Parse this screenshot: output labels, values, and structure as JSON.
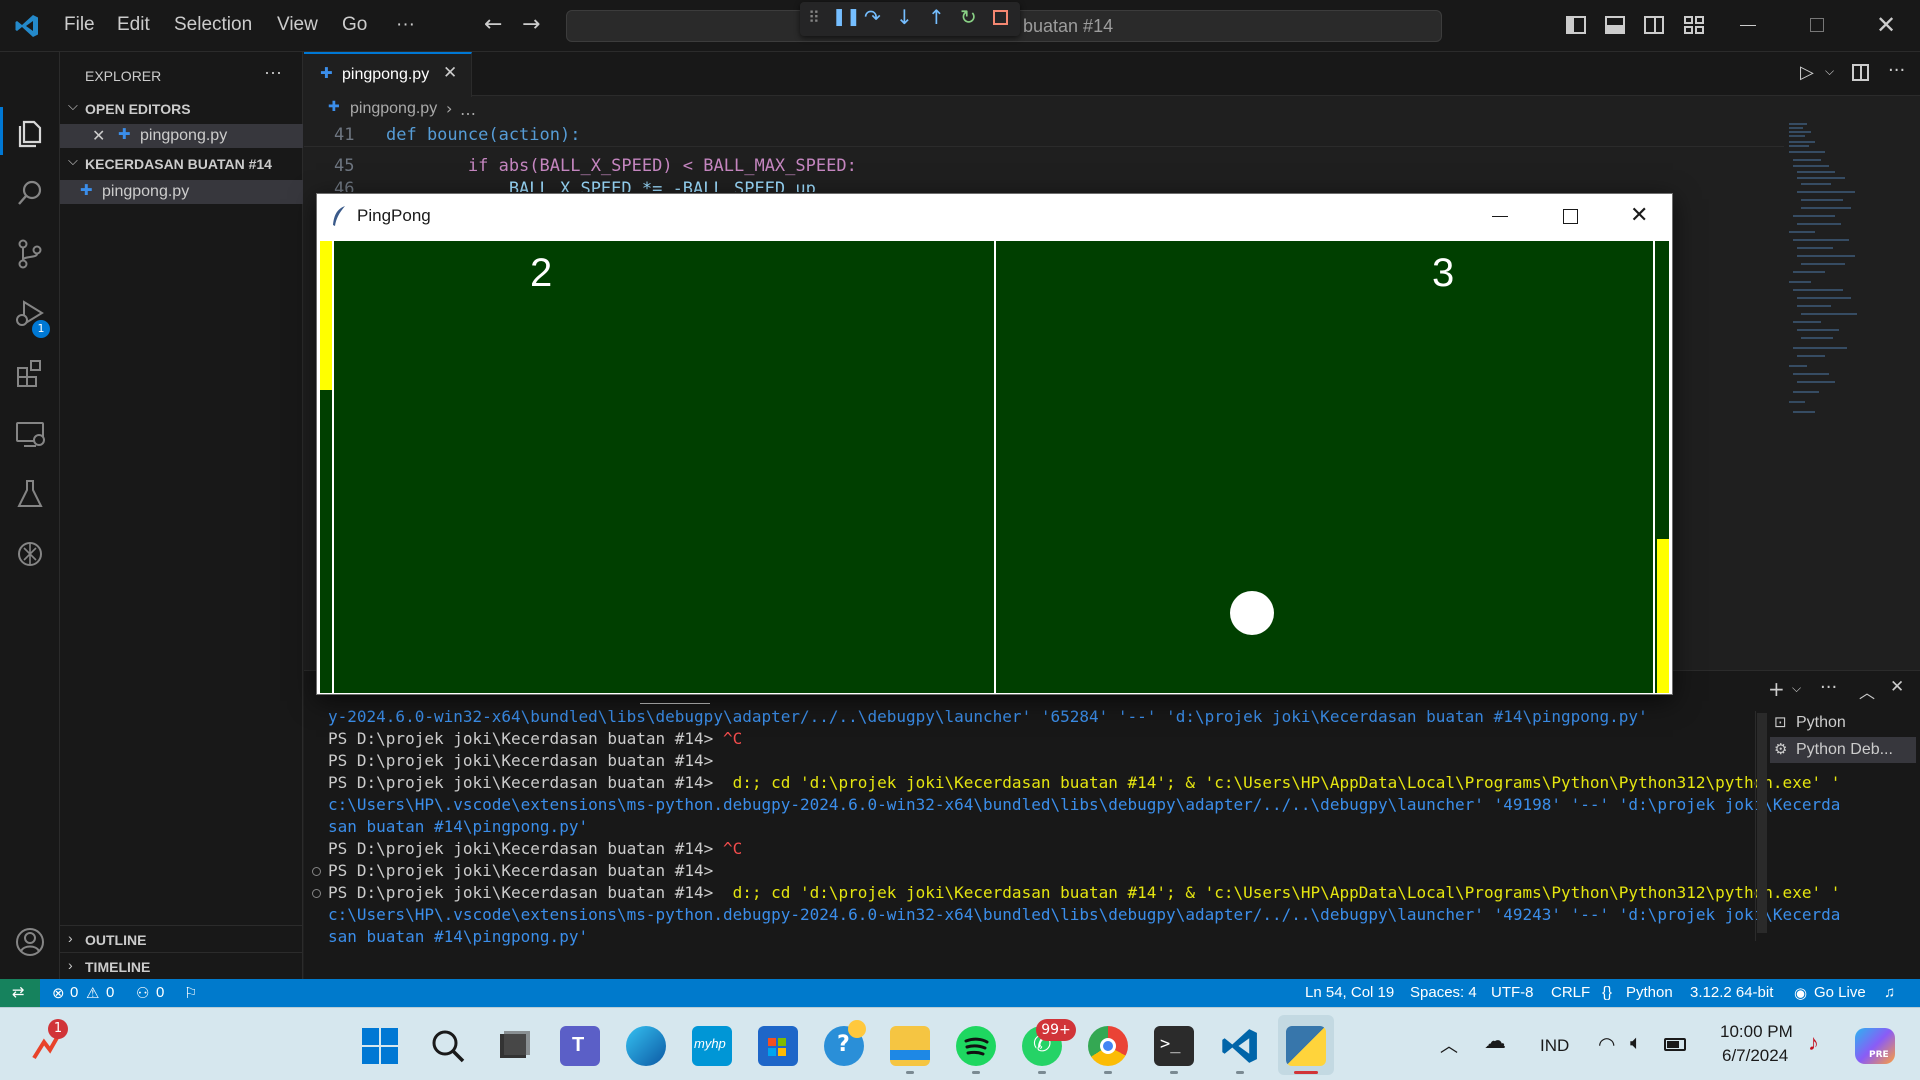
{
  "titlebar": {
    "menus": [
      "File",
      "Edit",
      "Selection",
      "View",
      "Go",
      "···"
    ],
    "search_text": "buatan #14"
  },
  "activity": {
    "debug_badge": "1"
  },
  "sidebar": {
    "header": "EXPLORER",
    "more": "···",
    "open_editors_label": "OPEN EDITORS",
    "open_editor_file": "pingpong.py",
    "folder_label": "KECERDASAN BUATAN #14",
    "folder_file": "pingpong.py",
    "outline_label": "OUTLINE",
    "timeline_label": "TIMELINE"
  },
  "editor": {
    "tab_label": "pingpong.py",
    "breadcrumb_file": "pingpong.py",
    "breadcrumb_rest": "…",
    "lines": [
      {
        "num": "41",
        "text": "def bounce(action):"
      },
      {
        "num": "45",
        "text": "        if abs(BALL_X_SPEED) < BALL_MAX_SPEED:"
      },
      {
        "num": "46",
        "text": "            BALL_X_SPEED *= -BALL_SPEED_up"
      }
    ]
  },
  "pingpong": {
    "title": "PingPong",
    "score_left": "2",
    "score_right": "3",
    "left_paddle_fill": 0.33,
    "right_paddle_fill": 0.34
  },
  "terminal": {
    "lines": [
      {
        "prompt": "",
        "text": "y-2024.6.0-win32-x64\\bundled\\libs\\debugpy\\adapter/../..\\debugpy\\launcher' '65284' '--' 'd:\\projek joki\\Kecerdasan buatan #14\\pingpong.py'",
        "style": "blue"
      },
      {
        "prompt": "PS D:\\projek joki\\Kecerdasan buatan #14> ",
        "text": "^C",
        "style": "red"
      },
      {
        "prompt": "PS D:\\projek joki\\Kecerdasan buatan #14>",
        "text": "",
        "style": ""
      },
      {
        "prompt": "PS D:\\projek joki\\Kecerdasan buatan #14>  ",
        "text": "d:; cd 'd:\\projek joki\\Kecerdasan buatan #14'; & 'c:\\Users\\HP\\AppData\\Local\\Programs\\Python\\Python312\\python.exe' '",
        "style": "mixed"
      },
      {
        "prompt": "",
        "text": "c:\\Users\\HP\\.vscode\\extensions\\ms-python.debugpy-2024.6.0-win32-x64\\bundled\\libs\\debugpy\\adapter/../..\\debugpy\\launcher' '49198' '--' 'd:\\projek joki\\Kecerda",
        "style": "blue"
      },
      {
        "prompt": "",
        "text": "san buatan #14\\pingpong.py'",
        "style": "blue"
      },
      {
        "prompt": "PS D:\\projek joki\\Kecerdasan buatan #14> ",
        "text": "^C",
        "style": "red"
      },
      {
        "prompt": "PS D:\\projek joki\\Kecerdasan buatan #14>",
        "text": "",
        "style": ""
      },
      {
        "prompt": "PS D:\\projek joki\\Kecerdasan buatan #14>  ",
        "text": "d:; cd 'd:\\projek joki\\Kecerdasan buatan #14'; & 'c:\\Users\\HP\\AppData\\Local\\Programs\\Python\\Python312\\python.exe' '",
        "style": "mixed"
      },
      {
        "prompt": "",
        "text": "c:\\Users\\HP\\.vscode\\extensions\\ms-python.debugpy-2024.6.0-win32-x64\\bundled\\libs\\debugpy\\adapter/../..\\debugpy\\launcher' '49243' '--' 'd:\\projek joki\\Kecerda",
        "style": "blue"
      },
      {
        "prompt": "",
        "text": "san buatan #14\\pingpong.py'",
        "style": "blue"
      }
    ],
    "sessions": [
      "Python",
      "Python Deb..."
    ]
  },
  "statusbar": {
    "errors": "0",
    "warnings": "0",
    "ports": "0",
    "position": "Ln 54, Col 19",
    "spaces": "Spaces: 4",
    "encoding": "UTF-8",
    "eol": "CRLF",
    "language": "Python",
    "interpreter": "3.12.2 64-bit",
    "golive": "Go Live"
  },
  "taskbar": {
    "notif_badge": "1",
    "whatsapp_badge": "99+",
    "language": "IND",
    "time": "10:00 PM",
    "date": "6/7/2024",
    "copilot_tag": "PRE"
  },
  "colors": {
    "accent": "#0078d4",
    "statusbar": "#007acc",
    "game_bg": "#003f00",
    "paddle": "#ffff00"
  }
}
